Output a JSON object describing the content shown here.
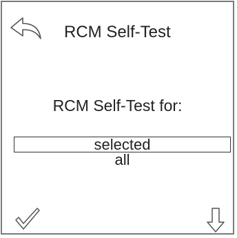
{
  "header": {
    "title": "RCM Self-Test",
    "back_icon": "back-arrow-icon"
  },
  "main": {
    "prompt": "RCM Self-Test for:",
    "options": [
      {
        "label": "selected",
        "is_selected": true
      },
      {
        "label": "all",
        "is_selected": false
      }
    ]
  },
  "footer": {
    "confirm_icon": "checkmark-icon",
    "down_icon": "arrow-down-icon"
  },
  "colors": {
    "frame_border": "#7a7a7a",
    "icon_stroke": "#555555",
    "text": "#222222",
    "background": "#ffffff"
  }
}
